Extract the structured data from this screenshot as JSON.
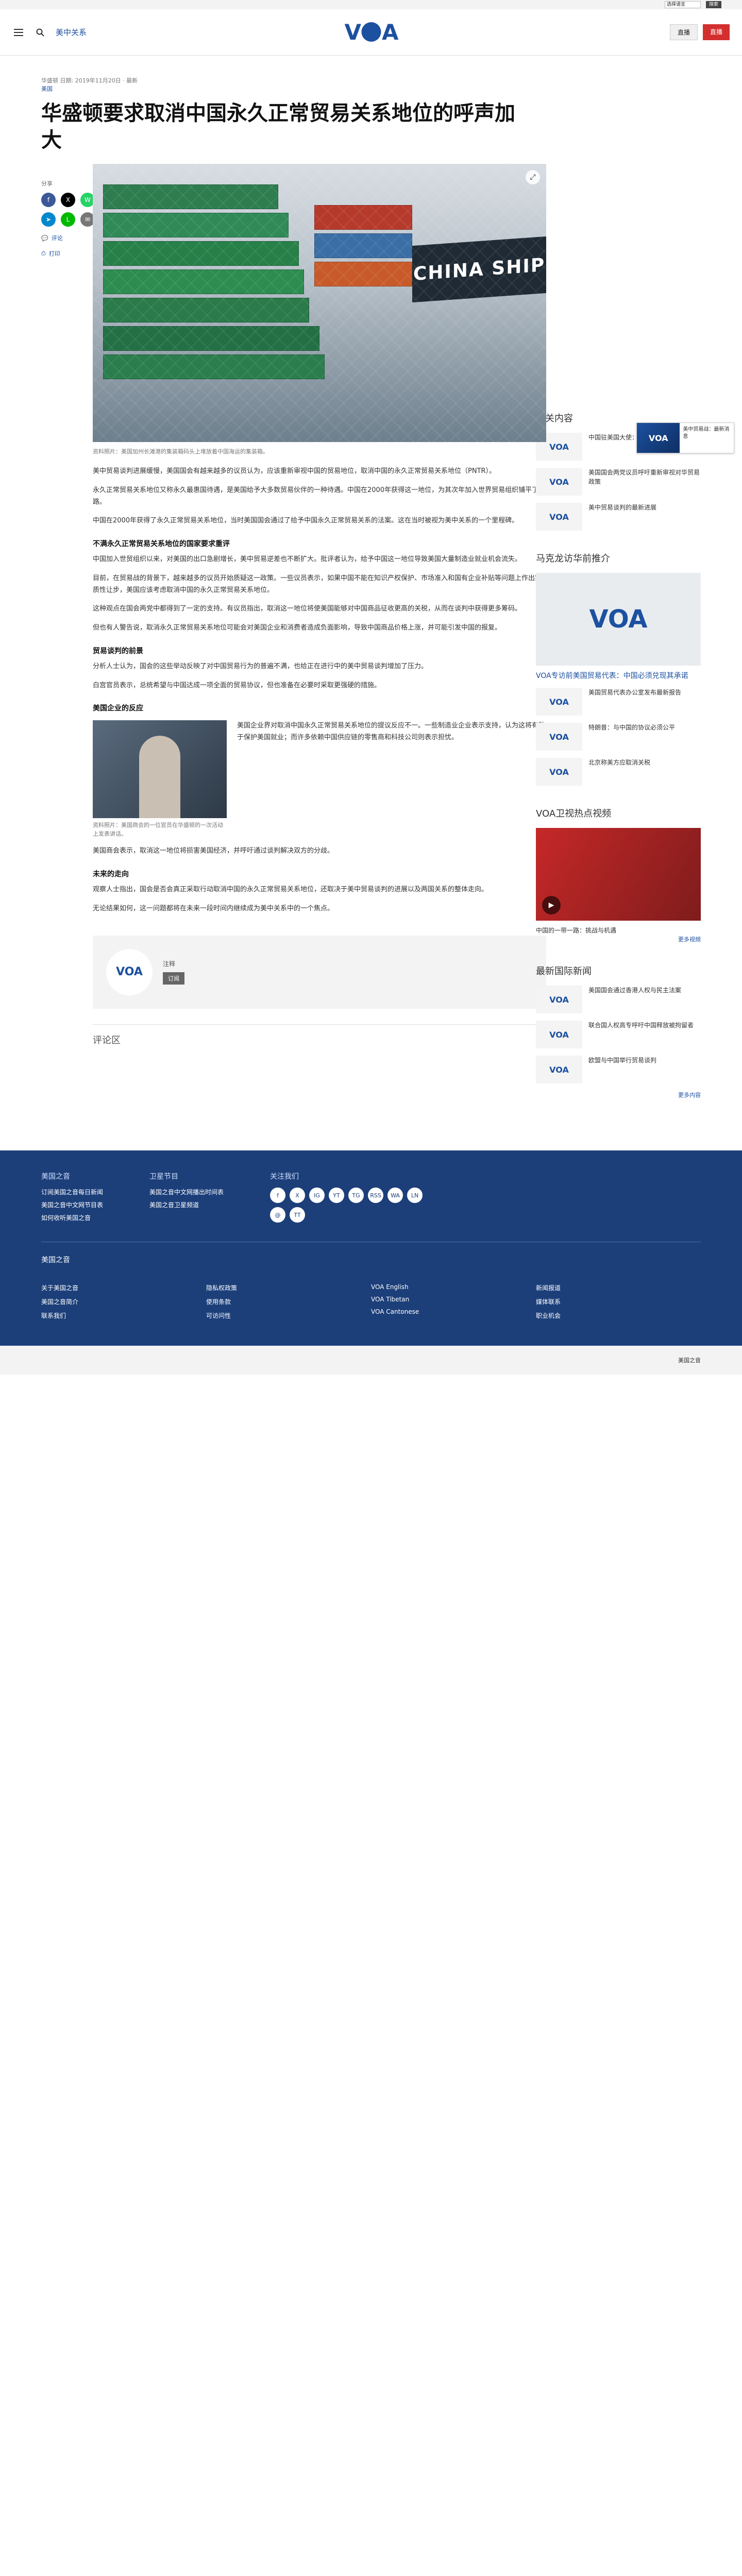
{
  "util": {
    "language_label": "选择语言",
    "search_label": "搜索"
  },
  "header": {
    "section": "美中关系",
    "logo": "VOA",
    "live_label": "直播",
    "red_label": "直播"
  },
  "article": {
    "breadcrumb_date": "华盛顿 日期: 2019年11月20日 · 最新",
    "breadcrumb_cat": "美国",
    "title": "华盛顿要求取消中国永久正常贸易关系地位的呼声加大",
    "share_label": "分享",
    "side_links": [
      "评论",
      "打印"
    ],
    "caption": "资料照片：美国加州长滩港的集装箱码头上堆放着中国海运的集装箱。",
    "sections": [
      {
        "type": "para",
        "text": "美中贸易谈判进展缓慢，美国国会有越来越多的议员认为，应该重新审视中国的贸易地位，取消中国的永久正常贸易关系地位（PNTR）。"
      },
      {
        "type": "para",
        "text": "永久正常贸易关系地位又称永久最惠国待遇，是美国给予大多数贸易伙伴的一种待遇。中国在2000年获得这一地位，为其次年加入世界贸易组织铺平了道路。"
      },
      {
        "type": "para",
        "text": "中国在2000年获得了永久正常贸易关系地位，当时美国国会通过了给予中国永久正常贸易关系的法案。这在当时被视为美中关系的一个里程碑。"
      },
      {
        "type": "subhead",
        "text": "不满永久正常贸易关系地位的国家要求重评"
      },
      {
        "type": "para",
        "text": "中国加入世贸组织以来，对美国的出口急剧增长，美中贸易逆差也不断扩大。批评者认为，给予中国这一地位导致美国大量制造业就业机会流失。"
      },
      {
        "type": "para",
        "text": "目前，在贸易战的背景下，越来越多的议员开始质疑这一政策。一些议员表示，如果中国不能在知识产权保护、市场准入和国有企业补贴等问题上作出实质性让步，美国应该考虑取消中国的永久正常贸易关系地位。"
      },
      {
        "type": "para",
        "text": "这种观点在国会两党中都得到了一定的支持。有议员指出，取消这一地位将使美国能够对中国商品征收更高的关税，从而在谈判中获得更多筹码。"
      },
      {
        "type": "para",
        "text": "但也有人警告说，取消永久正常贸易关系地位可能会对美国企业和消费者造成负面影响，导致中国商品价格上涨，并可能引发中国的报复。"
      },
      {
        "type": "subhead",
        "text": "贸易谈判的前景"
      },
      {
        "type": "para",
        "text": "分析人士认为，国会的这些举动反映了对中国贸易行为的普遍不满，也给正在进行中的美中贸易谈判增加了压力。"
      },
      {
        "type": "para",
        "text": "白宫官员表示，总统希望与中国达成一项全面的贸易协议，但也准备在必要时采取更强硬的措施。"
      },
      {
        "type": "subhead",
        "text": "美国企业的反应"
      },
      {
        "type": "figure",
        "caption": "资料照片：美国商会的一位官员在华盛顿的一次活动上发表讲话。",
        "text": "美国企业界对取消中国永久正常贸易关系地位的提议反应不一。一些制造业企业表示支持，认为这将有助于保护美国就业；而许多依赖中国供应链的零售商和科技公司则表示担忧。"
      },
      {
        "type": "para",
        "text": "美国商会表示，取消这一地位将损害美国经济，并呼吁通过谈判解决双方的分歧。"
      },
      {
        "type": "subhead",
        "text": "未来的走向"
      },
      {
        "type": "para",
        "text": "观察人士指出，国会是否会真正采取行动取消中国的永久正常贸易关系地位，还取决于美中贸易谈判的进展以及两国关系的整体走向。"
      },
      {
        "type": "para",
        "text": "无论结果如何，这一问题都将在未来一段时间内继续成为美中关系中的一个焦点。"
      }
    ],
    "related_label": "注释",
    "related_tag": "订阅",
    "comments_title": "评论区"
  },
  "sidebar": {
    "latest_title": "相关内容",
    "latest": [
      "中国驻美国大使：中美贸易谈判",
      "美国国会两党议员呼吁重新审视对华贸易政策",
      "美中贸易谈判的最新进展"
    ],
    "feature_title": "马克龙访华前推介",
    "feature_text": "VOA专访前美国贸易代表：中国必须兑现其承诺",
    "more_items": [
      "美国贸易代表办公室发布最新报告",
      "特朗普：与中国的协议必须公平",
      "北京称美方应取消关税"
    ],
    "video_title": "VOA卫视热点视频",
    "video_text": "中国的一带一路：挑战与机遇",
    "more_video": "更多视频",
    "news_title": "最新国际新闻",
    "news_items": [
      "美国国会通过香港人权与民主法案",
      "联合国人权高专呼吁中国释放被拘留者",
      "欧盟与中国举行贸易谈判"
    ],
    "more_news": "更多内容"
  },
  "floating": {
    "text": "美中贸易战：最新消息"
  },
  "footer": {
    "col1_title": "美国之音",
    "col1_links": [
      "订阅美国之音每日新闻",
      "美国之音中文网节目表",
      "如何收听美国之音"
    ],
    "col2_title": "卫星节目",
    "col2_links": [
      "美国之音中文网播出时间表",
      "美国之音卫星频道"
    ],
    "col3_title": "关注我们",
    "social": [
      "f",
      "X",
      "IG",
      "YT",
      "TG",
      "RSS",
      "WA",
      "LN",
      "@",
      "TT"
    ],
    "bottom_title": "美国之音",
    "bottom_cols": [
      [
        "关于美国之音",
        "美国之音简介",
        "联系我们"
      ],
      [
        "隐私权政策",
        "使用条款",
        "可访问性"
      ],
      [
        "VOA English",
        "VOA Tibetan",
        "VOA Cantonese"
      ],
      [
        "新闻报道",
        "媒体联系",
        "职业机会"
      ]
    ],
    "copyright": "美国之音"
  }
}
